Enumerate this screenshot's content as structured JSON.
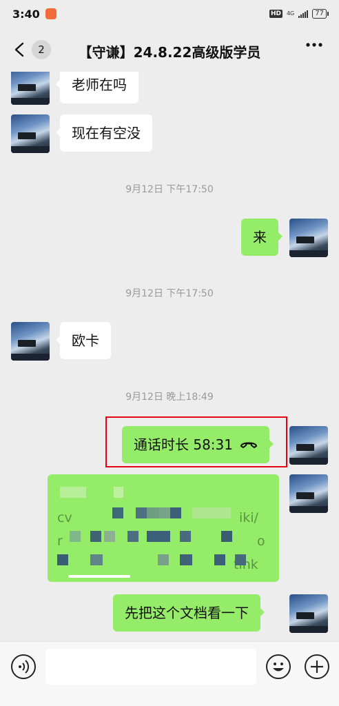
{
  "status_bar": {
    "time": "3:40",
    "hd": "HD",
    "network": "4G",
    "battery": "77"
  },
  "header": {
    "unread_count": "2",
    "title": "【守谦】24.8.22高级版学员"
  },
  "messages": [
    {
      "side": "in",
      "text": "老师在吗"
    },
    {
      "side": "in",
      "text": "现在有空没"
    },
    {
      "timestamp": "9月12日 下午17:50"
    },
    {
      "side": "out",
      "text": "来"
    },
    {
      "timestamp": "9月12日 下午17:50"
    },
    {
      "side": "in",
      "text": "欧卡"
    },
    {
      "timestamp": "9月12日 晚上18:49"
    },
    {
      "side": "out",
      "type": "call",
      "text": "通话时长 58:31",
      "highlighted": true
    },
    {
      "side": "out",
      "type": "link",
      "text_fragments": [
        "cv",
        "iki/",
        "r",
        "o",
        "tink"
      ],
      "redacted": true
    },
    {
      "side": "out",
      "text": "先把这个文档看一下"
    }
  ],
  "input_bar": {
    "placeholder": ""
  },
  "colors": {
    "chat_background": "#ededed",
    "outgoing_bubble": "#95ec69",
    "incoming_bubble": "#ffffff",
    "highlight_border": "#e60012",
    "timestamp_text": "#999999"
  },
  "icons": [
    "back-arrow-icon",
    "more-dots-icon",
    "hangup-phone-icon",
    "voice-icon",
    "emoji-icon",
    "plus-icon"
  ]
}
